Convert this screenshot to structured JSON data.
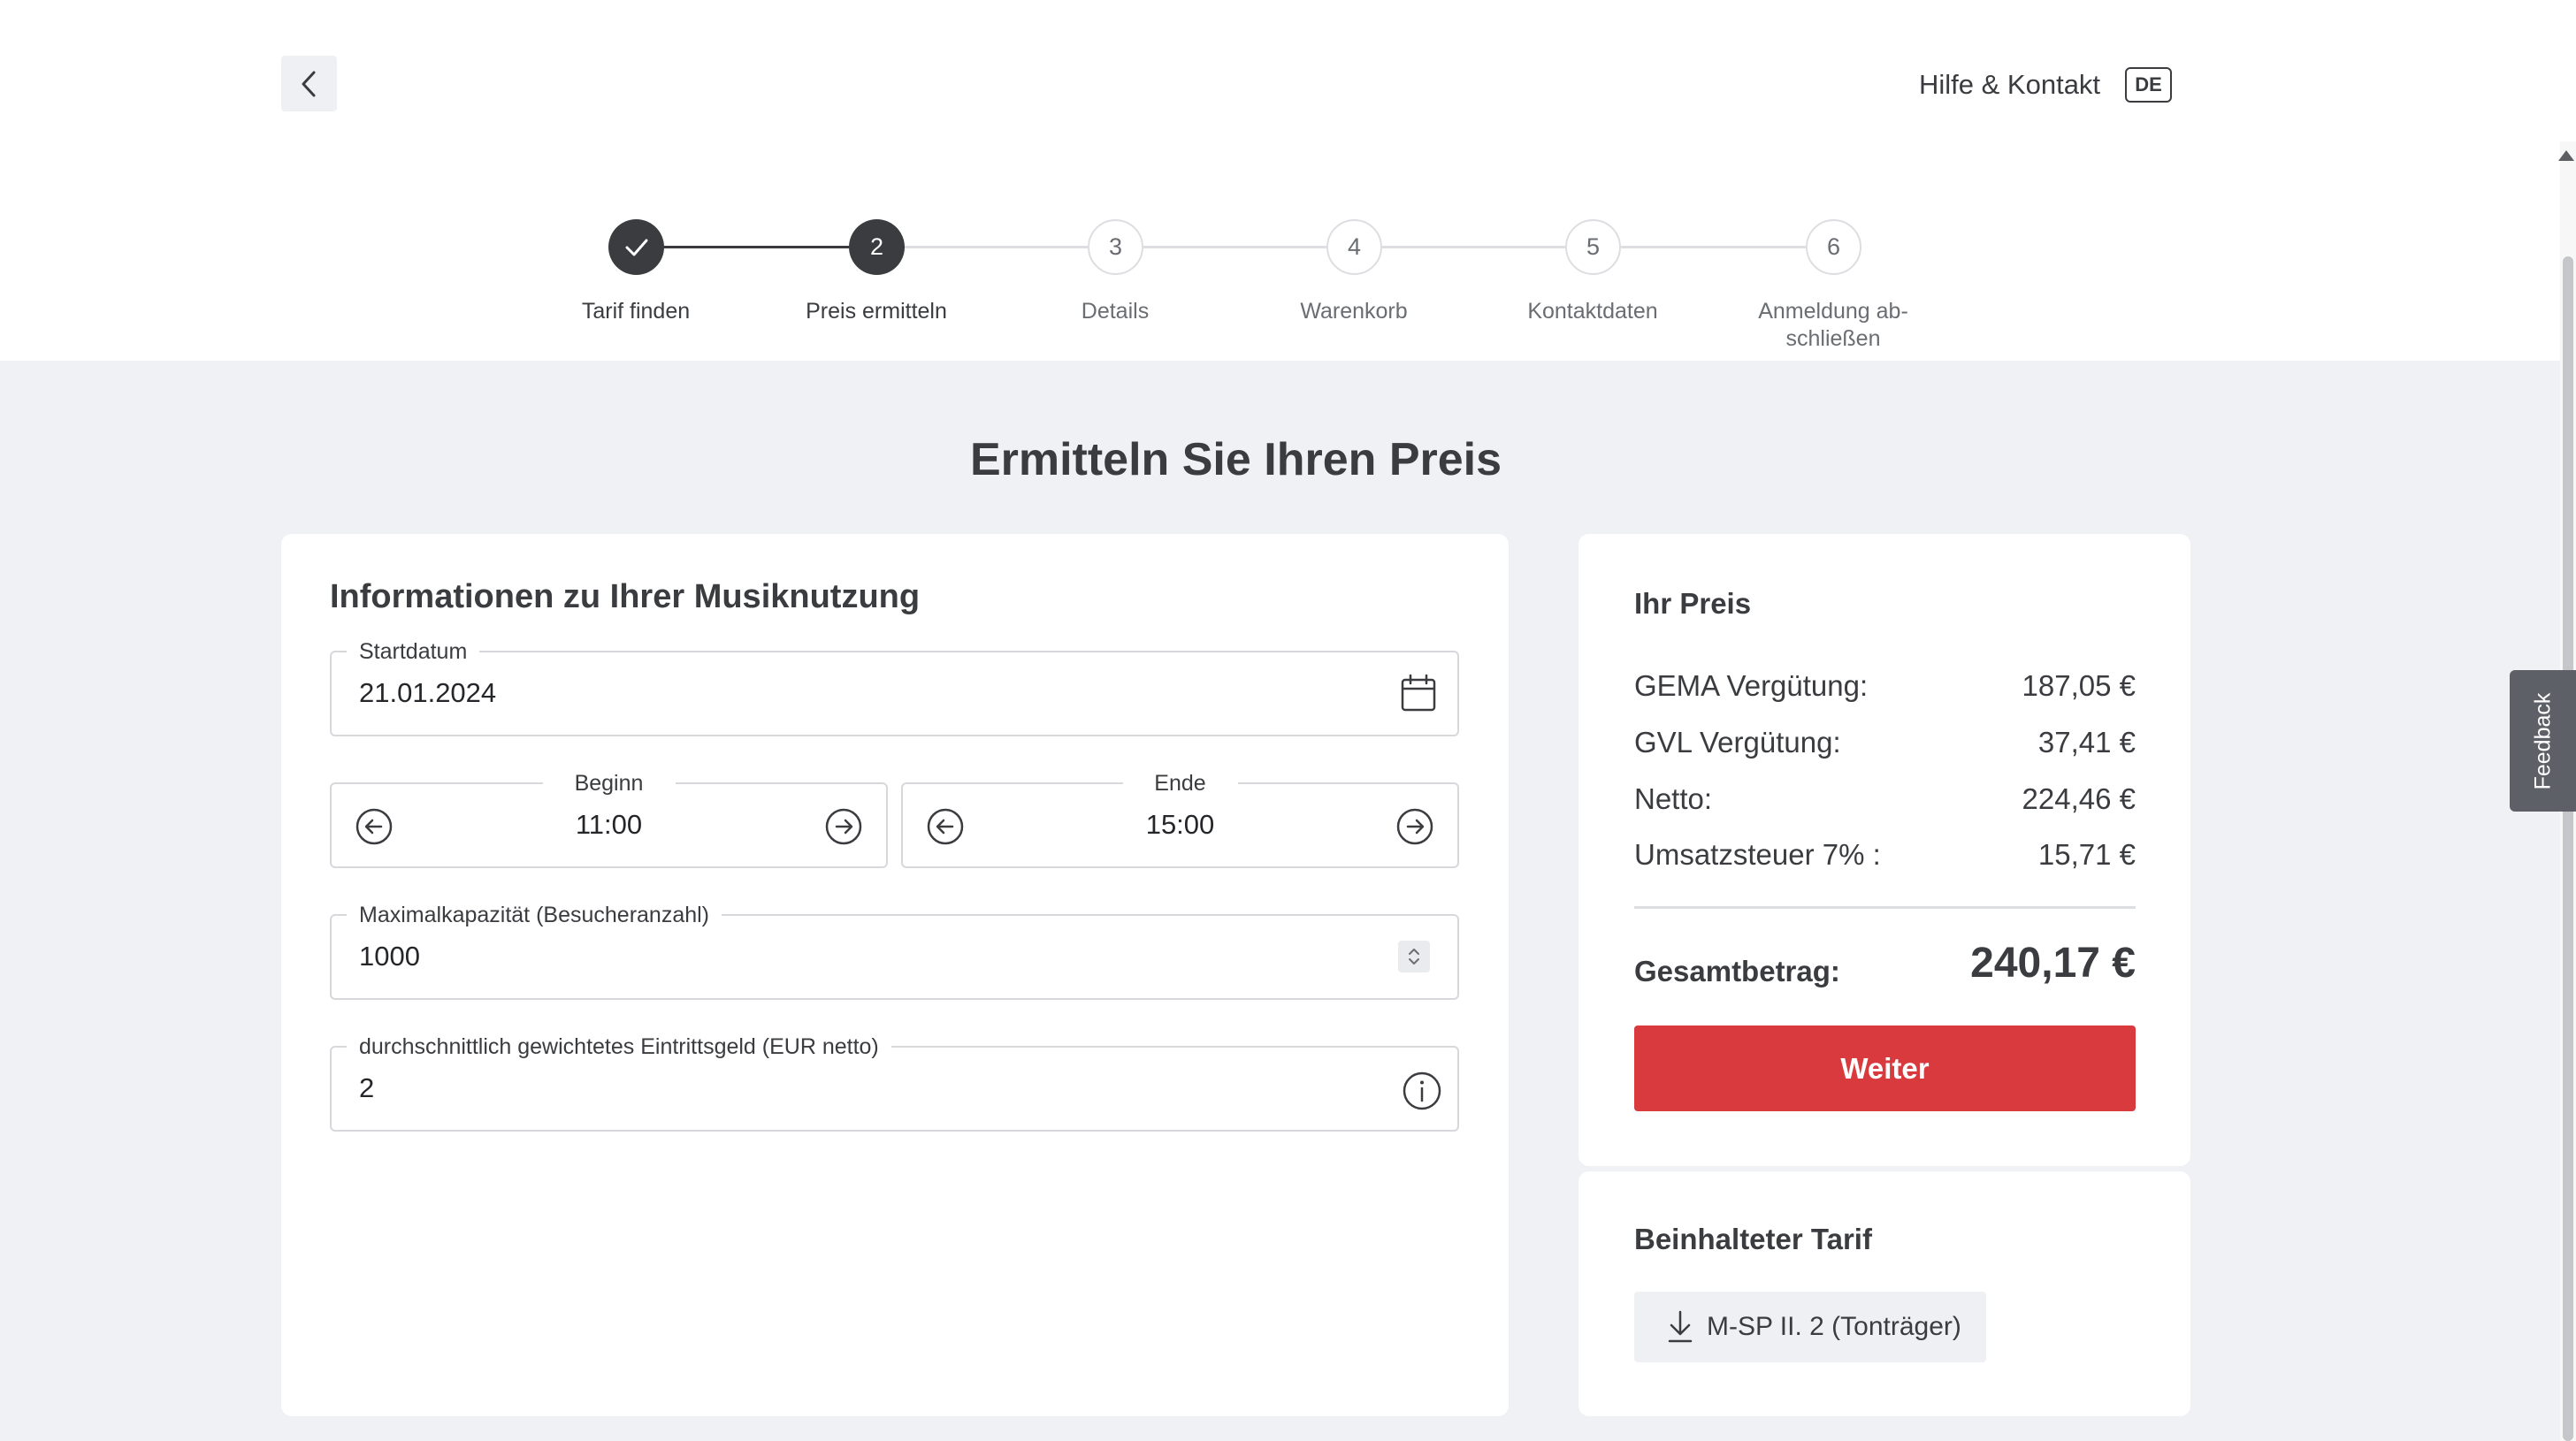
{
  "header": {
    "help_label": "Hilfe & Kontakt",
    "language": "DE"
  },
  "stepper": {
    "steps": [
      {
        "number": "",
        "label": "Tarif finden",
        "state": "done"
      },
      {
        "number": "2",
        "label": "Preis ermitteln",
        "state": "active"
      },
      {
        "number": "3",
        "label": "Details",
        "state": "todo"
      },
      {
        "number": "4",
        "label": "Warenkorb",
        "state": "todo"
      },
      {
        "number": "5",
        "label": "Kontaktdaten",
        "state": "todo"
      },
      {
        "number": "6",
        "label_line1": "Anmeldung ab-",
        "label_line2": "schließen",
        "state": "todo"
      }
    ]
  },
  "page_title": "Ermitteln Sie Ihren Preis",
  "form": {
    "title": "Informationen zu Ihrer Musiknutzung",
    "start_date": {
      "label": "Startdatum",
      "value": "21.01.2024"
    },
    "begin": {
      "label": "Beginn",
      "value": "11:00"
    },
    "end": {
      "label": "Ende",
      "value": "15:00"
    },
    "capacity": {
      "label": "Maximalkapazität (Besucheranzahl)",
      "value": "1000"
    },
    "entry_fee": {
      "label": "durchschnittlich gewichtetes Eintrittsgeld (EUR netto)",
      "value": "2"
    }
  },
  "price": {
    "title": "Ihr Preis",
    "rows": [
      {
        "label": "GEMA Vergütung:",
        "value": "187,05 €"
      },
      {
        "label": "GVL Vergütung:",
        "value": "37,41 €"
      },
      {
        "label": "Netto:",
        "value": "224,46 €"
      },
      {
        "label": "Umsatzsteuer 7% :",
        "value": "15,71 €"
      }
    ],
    "total_label": "Gesamtbetrag:",
    "total_value": "240,17 €",
    "cta_label": "Weiter"
  },
  "tarif": {
    "title": "Beinhalteter Tarif",
    "chip_label": "M-SP II. 2 (Tonträger)"
  },
  "feedback_label": "Feedback",
  "colors": {
    "accent": "#d93a3e",
    "dark": "#3a3c40",
    "background": "#f0f1f4"
  }
}
